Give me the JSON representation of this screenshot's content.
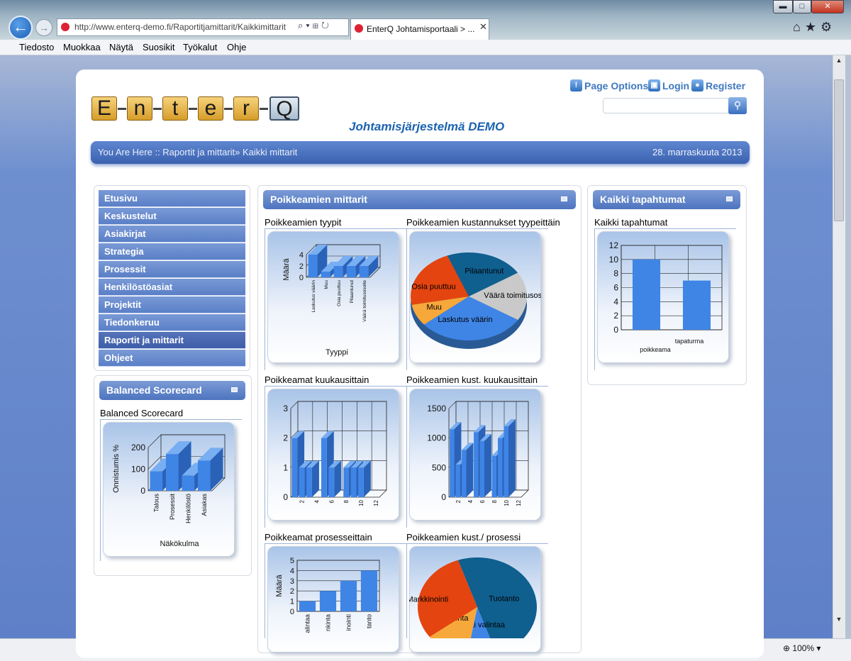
{
  "browser": {
    "url": "http://www.enterq-demo.fi/Raportitjamittarit/Kaikkimittarit",
    "tab_title": "EnterQ Johtamisportaali > ...",
    "zoom": "100%",
    "menu": [
      "Tiedosto",
      "Muokkaa",
      "Näytä",
      "Suosikit",
      "Työkalut",
      "Ohje"
    ]
  },
  "header": {
    "logo_letters": [
      "E",
      "n",
      "t",
      "e",
      "r",
      "Q"
    ],
    "site_title": "Johtamisjärjestelmä DEMO",
    "links": {
      "page_options": "Page Options",
      "login": "Login",
      "register": "Register"
    },
    "breadcrumb": "You Are Here :: Raportit ja mittarit» Kaikki mittarit",
    "date": "28. marraskuuta 2013"
  },
  "nav": {
    "items": [
      "Etusivu",
      "Keskustelut",
      "Asiakirjat",
      "Strategia",
      "Prosessit",
      "Henkilöstöasiat",
      "Projektit",
      "Tiedonkeruu",
      "Raportit ja mittarit",
      "Ohjeet"
    ],
    "active": "Raportit ja mittarit"
  },
  "panels": {
    "balanced": "Balanced Scorecard",
    "poikkeamien": "Poikkeamien mittarit",
    "kaikki": "Kaikki tapahtumat"
  },
  "chart_titles": {
    "bsc": "Balanced Scorecard",
    "tyypit": "Poikkeamien tyypit",
    "kustannukset_tyypeittain": "Poikkeamien kustannukset tyypeittäin",
    "kuukausittain": "Poikkeamat kuukausittain",
    "kust_kuukausittain": "Poikkeamien kust. kuukausittain",
    "prosesseittain": "Poikkeamat prosesseittain",
    "kust_prosessi": "Poikkeamien kust./ prosessi",
    "kaikki": "Kaikki tapahtumat"
  },
  "chart_data": [
    {
      "id": "bsc",
      "type": "bar",
      "categories": [
        "Talous",
        "Prosessit",
        "Henkilöstö",
        "Asiakas"
      ],
      "values": [
        90,
        170,
        70,
        140
      ],
      "xlabel": "Näkökulma",
      "ylabel": "Onnistumis %",
      "ylim": [
        0,
        200
      ],
      "yticks": [
        0,
        100,
        200
      ],
      "colors": [
        "#3f85e6"
      ]
    },
    {
      "id": "tyypit",
      "type": "bar",
      "categories": [
        "Laskutus väärin",
        "Muu",
        "Osia puuttuu",
        "Pilaantunut",
        "Väärä toimitusosoite"
      ],
      "values": [
        4,
        1,
        2,
        2,
        2
      ],
      "xlabel": "Tyyppi",
      "ylabel": "Määrä",
      "ylim": [
        0,
        4
      ],
      "yticks": [
        0,
        2,
        4
      ]
    },
    {
      "id": "kustannukset_tyypeittain",
      "type": "pie",
      "labels": [
        "Pilaantunut",
        "Väärä toimitusosoite",
        "Laskutus väärin",
        "Muu",
        "Osia puuttuu"
      ],
      "values": [
        22,
        18,
        30,
        8,
        22
      ],
      "colors": [
        "#0f5f8f",
        "#c9c9c9",
        "#3f85e6",
        "#f7a83a",
        "#e4440f"
      ]
    },
    {
      "id": "kuukausittain",
      "type": "bar",
      "categories": [
        "1",
        "2",
        "3",
        "4",
        "5",
        "6",
        "7",
        "8",
        "9",
        "10",
        "11",
        "12"
      ],
      "values": [
        2,
        1,
        1,
        0,
        2,
        1,
        0,
        1,
        1,
        1,
        0,
        0
      ],
      "xticks": [
        "2",
        "4",
        "6",
        "8",
        "10",
        "12"
      ],
      "ylim": [
        0,
        3
      ],
      "yticks": [
        0,
        1,
        2,
        3
      ]
    },
    {
      "id": "kust_kuukausittain",
      "type": "bar",
      "categories": [
        "1",
        "2",
        "3",
        "4",
        "5",
        "6",
        "7",
        "8",
        "9",
        "10",
        "11",
        "12"
      ],
      "values": [
        1150,
        550,
        800,
        0,
        1100,
        950,
        0,
        700,
        1000,
        1200,
        0,
        0
      ],
      "xticks": [
        "2",
        "4",
        "6",
        "8",
        "10",
        "12"
      ],
      "ylim": [
        0,
        1500
      ],
      "yticks": [
        0,
        500,
        1000,
        1500
      ]
    },
    {
      "id": "prosesseittain",
      "type": "bar",
      "categories": [
        "Ei valintaa",
        "Hankinta",
        "Markkinointi",
        "Tuotanto"
      ],
      "values": [
        1,
        2,
        3,
        4
      ],
      "tick_labels": [
        "alintaa",
        "nkinta",
        "inointi",
        "tanto"
      ],
      "ylabel": "Määrä",
      "ylim": [
        0,
        5
      ],
      "yticks": [
        0,
        1,
        2,
        3,
        4,
        5
      ]
    },
    {
      "id": "kust_prosessi",
      "type": "pie",
      "labels": [
        "Tuotanto",
        "Ei valintaa",
        "Hankinta",
        "Markkinointi"
      ],
      "values": [
        50,
        8,
        12,
        30
      ],
      "colors": [
        "#0f5f8f",
        "#3f85e6",
        "#f7a83a",
        "#e4440f"
      ]
    },
    {
      "id": "kaikki",
      "type": "bar",
      "categories": [
        "poikkeama",
        "tapaturma"
      ],
      "values": [
        10,
        7
      ],
      "ylim": [
        0,
        12
      ],
      "yticks": [
        0,
        2,
        4,
        6,
        8,
        10,
        12
      ]
    }
  ]
}
